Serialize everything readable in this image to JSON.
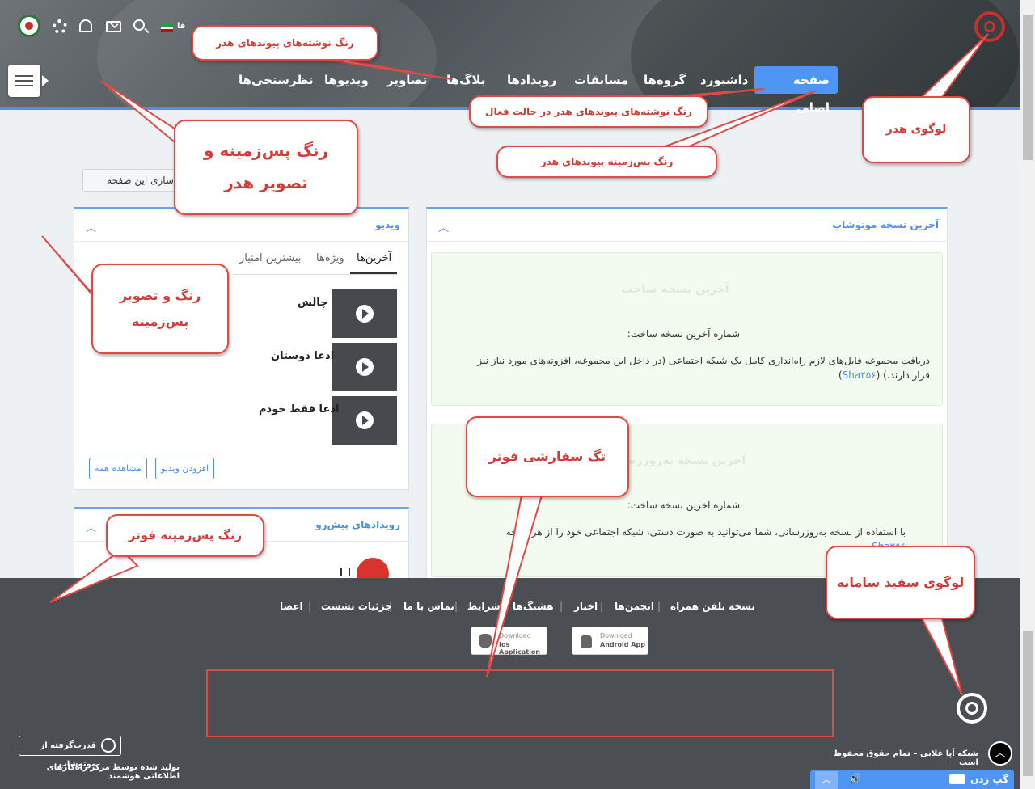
{
  "header": {
    "lang": "فا",
    "nav": [
      {
        "label": "صفحه اصلی",
        "active": true
      },
      {
        "label": "داشبورد"
      },
      {
        "label": "گروه‌ها"
      },
      {
        "label": "مسابقات"
      },
      {
        "label": "رویدادها"
      },
      {
        "label": "بلاگ‌ها"
      },
      {
        "label": "تصاویر"
      },
      {
        "label": "ویدیوها"
      },
      {
        "label": "نظرسنجی‌ها"
      }
    ],
    "icons": [
      "profile-logo-icon",
      "gear-icon",
      "bell-icon",
      "mail-icon",
      "search-icon",
      "iran-flag-icon"
    ]
  },
  "customize_button": "شی‌سازی این صفحه",
  "left_panel": {
    "title": "ویدیو",
    "tabs": [
      "آخرین‌ها",
      "ویژه‌ها",
      "بیشترین امتیاز"
    ],
    "videos": [
      "چالش",
      "ادعا دوستان",
      "ادعا فقط خودم"
    ],
    "add_video": "افزودن ویدیو",
    "view_all": "مشاهده همه"
  },
  "events_panel": {
    "title": "رویدادهای پیش‌رو"
  },
  "right_panel": {
    "title": "آخرین نسخه موتوشاب",
    "box1": {
      "heading": "آخرین نسخه ساخت",
      "build_label": "شماره آخرین نسخه ساخت:",
      "desc": "دریافت مجموعه فایل‌های لازم راه‌اندازی کامل یک شبکه اجتماعی (در داخل این مجموعه، افزونه‌های مورد نیاز نیز قرار دارند.) (",
      "link": "Sha۲۵۶",
      "close": ")"
    },
    "box2": {
      "heading": "آخرین نسخه به‌روزرسانی",
      "build_label": "شماره آخرین نسخه ساخت:",
      "desc": "با استفاده از نسخه به‌روزرسانی، شما می‌توانید به صورت دستی، شبکه اجتماعی خود را از هر نسخه",
      "link": "Sha۲۵۶"
    }
  },
  "footer": {
    "links": [
      "نسخه تلفن همراه",
      "انجمن‌ها",
      "اخبار",
      "هشتگ‌ها",
      "شرایط",
      "تماس با ما",
      "جزئیات نشست",
      "اعضا"
    ],
    "ios_download": "Download",
    "ios_app": "Ios Application",
    "android_download": "Download",
    "android_app": "Android App",
    "powered_by": "قدرت‌گرفته از موتوشاب",
    "produced_by": "تولید شده توسط مرکز راه‌کارهای اطلاعاتی هوشمند",
    "copyright": "شبکه آپا غلابی – تمام حقوق محفوظ است"
  },
  "chat_bar": {
    "label": "گپ زدن"
  },
  "annotations": {
    "header_links_color": "رنگ نوشته‌های پیوندهای هدر",
    "header_active_color": "رنگ نوشته‌های پیوندهای هدر در حالت فعال",
    "header_link_bg": "رنگ پس‌زمینه پیوندهای هدر",
    "header_logo": "لوگوی هدر",
    "header_bg_line1": "رنگ پس‌زمینه و",
    "header_bg_line2": "تصویر هدر",
    "page_bg_line1": "رنگ و تصویر",
    "page_bg_line2": "پس‌زمینه",
    "footer_custom_tag": "تگ سفارشی فوتر",
    "footer_bg": "رنگ پس‌زمینه فوتر",
    "white_logo": "لوگوی سفید سامانه"
  },
  "colors": {
    "accent": "#4f8fe8",
    "annotation_red": "#e14a44",
    "footer_bg": "#4b4f53",
    "green_box": "#f3fbf1"
  }
}
